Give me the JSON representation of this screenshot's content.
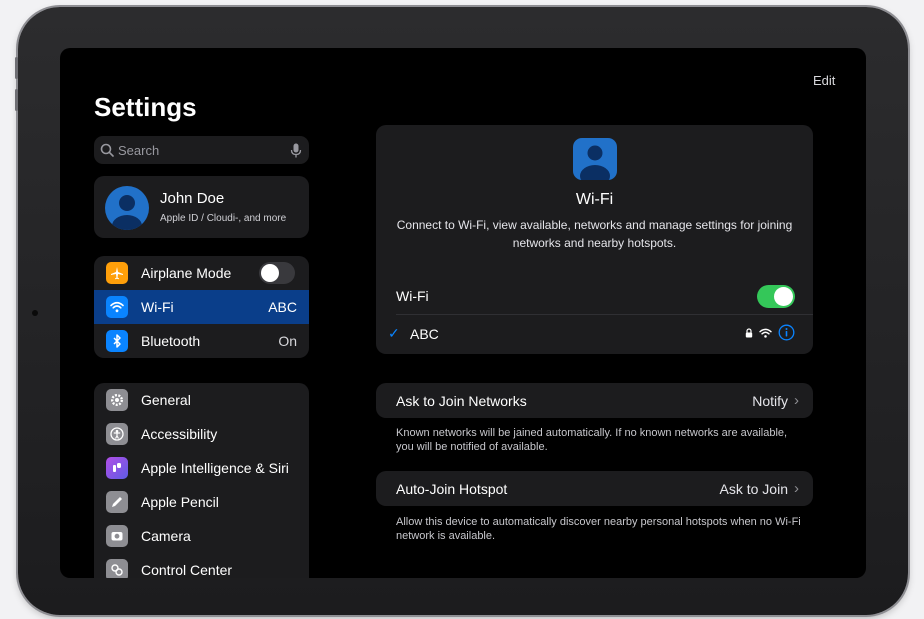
{
  "sidebar": {
    "title": "Settings",
    "search_placeholder": "Search",
    "profile": {
      "name": "John Doe",
      "subtitle": "Apple ID / Cloudi-, and more"
    },
    "connectivity": [
      {
        "label": "Airplane Mode",
        "icon": "airplane-icon",
        "color": "#ff9f0a"
      },
      {
        "label": "Wi-Fi",
        "value": "ABC",
        "icon": "wifi-icon",
        "color": "#0a84ff"
      },
      {
        "label": "Bluetooth",
        "value": "On",
        "icon": "bluetooth-icon",
        "color": "#0a84ff"
      }
    ],
    "general": [
      {
        "label": "General",
        "icon": "gear-icon",
        "color": "#8e8e93"
      },
      {
        "label": "Accessibility",
        "icon": "accessibility-icon",
        "color": "#8e8e93"
      },
      {
        "label": "Apple Intelligence & Siri",
        "icon": "siri-icon",
        "color": "#8e55e6"
      },
      {
        "label": "Apple Pencil",
        "icon": "pencil-icon",
        "color": "#8e8e93"
      },
      {
        "label": "Camera",
        "icon": "camera-icon",
        "color": "#8e8e93"
      },
      {
        "label": "Control Center",
        "icon": "control-center-icon",
        "color": "#8e8e93"
      }
    ]
  },
  "main": {
    "edit_label": "Edit",
    "wifi_card": {
      "title": "Wi-Fi",
      "description": "Connect to Wi-Fi, view available, networks and manage settings for joining networks and nearby hotspots.",
      "wifi_label": "Wi-Fi",
      "wifi_enabled": true,
      "network_name": "ABC"
    },
    "ask_to_join": {
      "label": "Ask to Join Networks",
      "value": "Notify",
      "footer": "Known networks will be jained automatically. If no known networks are available, you will be notified of available."
    },
    "auto_join": {
      "label": "Auto-Join Hotspot",
      "value": "Ask to Join",
      "footer": "Allow this device to automatically discover nearby personal hotspots when no Wi-Fi network is available."
    }
  },
  "colors": {
    "accent": "#0a84ff",
    "toggle_on": "#34c759",
    "selected_row": "#0a3e8a"
  }
}
